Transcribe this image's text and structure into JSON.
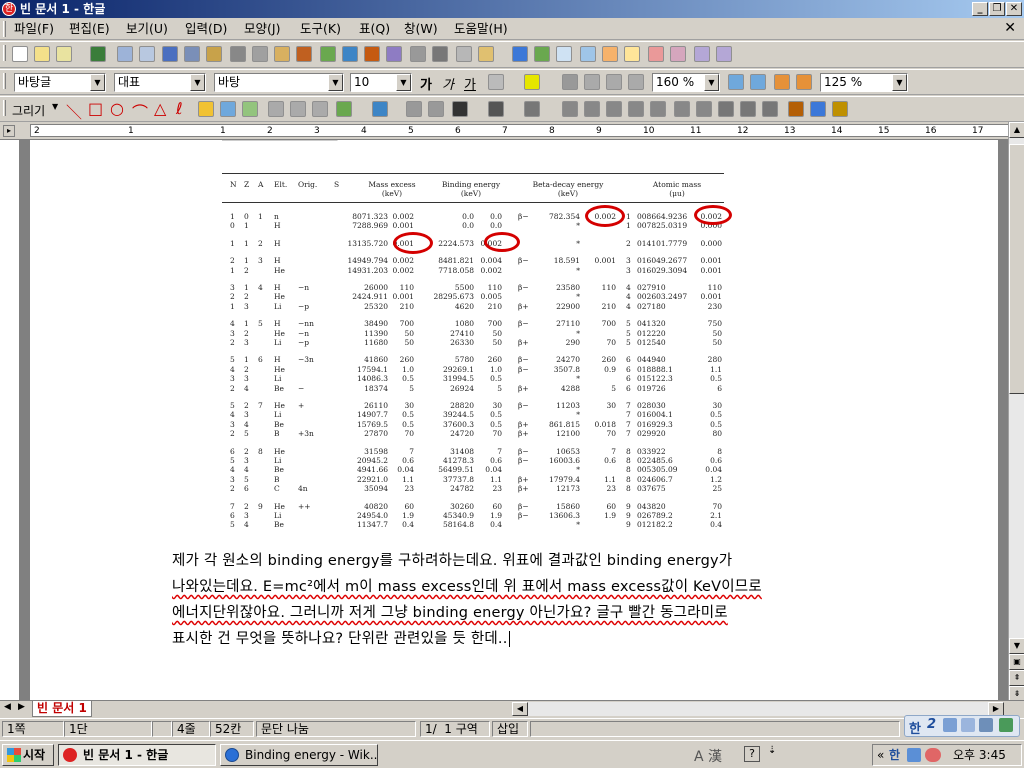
{
  "window": {
    "title": "빈 문서 1 - 한글",
    "app_icon": "hwp-logo-icon",
    "controls": [
      "minimize",
      "restore",
      "close"
    ]
  },
  "menubar": {
    "items": [
      "파일(F)",
      "편집(E)",
      "보기(U)",
      "입력(D)",
      "모양(J)",
      "도구(K)",
      "표(Q)",
      "창(W)",
      "도움말(H)"
    ]
  },
  "format_toolbar": {
    "style": "바탕글",
    "lang": "대표",
    "font": "바탕",
    "size": "10",
    "bold": "가",
    "italic": "가",
    "underline": "가",
    "line_spacing": "160 %",
    "zoom": "125 %"
  },
  "draw_toolbar": {
    "label": "그리기"
  },
  "ruler": {
    "numbers": [
      "2",
      "1",
      "1",
      "2",
      "3",
      "4",
      "5",
      "6",
      "7",
      "8",
      "9",
      "10",
      "11",
      "12",
      "13",
      "14",
      "15",
      "16",
      "17"
    ]
  },
  "table_image": {
    "headers": {
      "n": "N",
      "z": "Z",
      "a": "A",
      "elt": "Elt.",
      "orig": "Orig.",
      "s": "S",
      "mass_excess": "Mass excess\n(keV)",
      "binding": "Binding energy\n(keV)",
      "beta": "Beta-decay energy\n(keV)",
      "atomic": "Atomic mass\n(μu)"
    },
    "rows": [
      [
        "1",
        "0",
        "1",
        "n",
        "",
        "",
        "8071.323",
        "0.002",
        "0.0",
        "0.0",
        "β−",
        "782.354",
        "0.002",
        "1",
        "008664.9236",
        "0.002"
      ],
      [
        "0",
        "1",
        "",
        "H",
        "",
        "",
        "7288.969",
        "0.001",
        "0.0",
        "0.0",
        "",
        "*",
        "",
        "1",
        "007825.0319",
        "0.000"
      ],
      [
        "1",
        "1",
        "2",
        "H",
        "",
        "",
        "13135.720",
        "0.001",
        "2224.573",
        "0.002",
        "",
        "*",
        "",
        "2",
        "014101.7779",
        "0.000"
      ],
      [
        "2",
        "1",
        "3",
        "H",
        "",
        "",
        "14949.794",
        "0.002",
        "8481.821",
        "0.004",
        "β−",
        "18.591",
        "0.001",
        "3",
        "016049.2677",
        "0.001"
      ],
      [
        "1",
        "2",
        "",
        "He",
        "",
        "",
        "14931.203",
        "0.002",
        "7718.058",
        "0.002",
        "",
        "*",
        "",
        "3",
        "016029.3094",
        "0.001"
      ],
      [
        "3",
        "1",
        "4",
        "H",
        "−n",
        "",
        "26000",
        "110",
        "5500",
        "110",
        "β−",
        "23580",
        "110",
        "4",
        "027910",
        "110"
      ],
      [
        "2",
        "2",
        "",
        "He",
        "",
        "",
        "2424.911",
        "0.001",
        "28295.673",
        "0.005",
        "",
        "*",
        "",
        "4",
        "002603.2497",
        "0.001"
      ],
      [
        "1",
        "3",
        "",
        "Li",
        "−p",
        "",
        "25320",
        "210",
        "4620",
        "210",
        "β+",
        "22900",
        "210",
        "4",
        "027180",
        "230"
      ],
      [
        "4",
        "1",
        "5",
        "H",
        "−nn",
        "",
        "38490",
        "700",
        "1080",
        "700",
        "β−",
        "27110",
        "700",
        "5",
        "041320",
        "750"
      ],
      [
        "3",
        "2",
        "",
        "He",
        "−n",
        "",
        "11390",
        "50",
        "27410",
        "50",
        "",
        "*",
        "",
        "5",
        "012220",
        "50"
      ],
      [
        "2",
        "3",
        "",
        "Li",
        "−p",
        "",
        "11680",
        "50",
        "26330",
        "50",
        "β+",
        "290",
        "70",
        "5",
        "012540",
        "50"
      ],
      [
        "5",
        "1",
        "6",
        "H",
        "−3n",
        "",
        "41860",
        "260",
        "5780",
        "260",
        "β−",
        "24270",
        "260",
        "6",
        "044940",
        "280"
      ],
      [
        "4",
        "2",
        "",
        "He",
        "",
        "",
        "17594.1",
        "1.0",
        "29269.1",
        "1.0",
        "β−",
        "3507.8",
        "0.9",
        "6",
        "018888.1",
        "1.1"
      ],
      [
        "3",
        "3",
        "",
        "Li",
        "",
        "",
        "14086.3",
        "0.5",
        "31994.5",
        "0.5",
        "",
        "*",
        "",
        "6",
        "015122.3",
        "0.5"
      ],
      [
        "2",
        "4",
        "",
        "Be",
        "−",
        "",
        "18374",
        "5",
        "26924",
        "5",
        "β+",
        "4288",
        "5",
        "6",
        "019726",
        "6"
      ],
      [
        "5",
        "2",
        "7",
        "He",
        "+",
        "",
        "26110",
        "30",
        "28820",
        "30",
        "β−",
        "11203",
        "30",
        "7",
        "028030",
        "30"
      ],
      [
        "4",
        "3",
        "",
        "Li",
        "",
        "",
        "14907.7",
        "0.5",
        "39244.5",
        "0.5",
        "",
        "*",
        "",
        "7",
        "016004.1",
        "0.5"
      ],
      [
        "3",
        "4",
        "",
        "Be",
        "",
        "",
        "15769.5",
        "0.5",
        "37600.3",
        "0.5",
        "β+",
        "861.815",
        "0.018",
        "7",
        "016929.3",
        "0.5"
      ],
      [
        "2",
        "5",
        "",
        "B",
        "+3n",
        "",
        "27870",
        "70",
        "24720",
        "70",
        "β+",
        "12100",
        "70",
        "7",
        "029920",
        "80"
      ],
      [
        "6",
        "2",
        "8",
        "He",
        "",
        "",
        "31598",
        "7",
        "31408",
        "7",
        "β−",
        "10653",
        "7",
        "8",
        "033922",
        "8"
      ],
      [
        "5",
        "3",
        "",
        "Li",
        "",
        "",
        "20945.2",
        "0.6",
        "41278.3",
        "0.6",
        "β−",
        "16003.6",
        "0.6",
        "8",
        "022485.6",
        "0.6"
      ],
      [
        "4",
        "4",
        "",
        "Be",
        "",
        "",
        "4941.66",
        "0.04",
        "56499.51",
        "0.04",
        "",
        "*",
        "",
        "8",
        "005305.09",
        "0.04"
      ],
      [
        "3",
        "5",
        "",
        "B",
        "",
        "",
        "22921.0",
        "1.1",
        "37737.8",
        "1.1",
        "β+",
        "17979.4",
        "1.1",
        "8",
        "024606.7",
        "1.2"
      ],
      [
        "2",
        "6",
        "",
        "C",
        "4n",
        "",
        "35094",
        "23",
        "24782",
        "23",
        "β+",
        "12173",
        "23",
        "8",
        "037675",
        "25"
      ],
      [
        "7",
        "2",
        "9",
        "He",
        "++",
        "",
        "40820",
        "60",
        "30260",
        "60",
        "β−",
        "15860",
        "60",
        "9",
        "043820",
        "70"
      ],
      [
        "6",
        "3",
        "",
        "Li",
        "",
        "",
        "24954.0",
        "1.9",
        "45340.9",
        "1.9",
        "β−",
        "13606.3",
        "1.9",
        "9",
        "026789.2",
        "2.1"
      ],
      [
        "5",
        "4",
        "",
        "Be",
        "",
        "",
        "11347.7",
        "0.4",
        "58164.8",
        "0.4",
        "",
        "*",
        "",
        "9",
        "012182.2",
        "0.4"
      ]
    ]
  },
  "body_text": {
    "line1": "제가 각 원소의 binding energy를 구하려하는데요. 위표에 결과값인 binding energy가",
    "line2": "나와있는데요. E=mc²에서 m이 mass excess인데 위 표에서 mass excess값이 KeV이므로",
    "line3": "에너지단위잖아요. 그러니까 저게 그냥 binding energy 아닌가요? 글구 빨간 동그라미로",
    "line4": "표시한 건 무엇을 뜻하나요? 단위란 관련있을 듯 한데.."
  },
  "doc_tab": {
    "label": "빈 문서 1"
  },
  "statusbar": {
    "page": "1쪽",
    "section": "1단",
    "line": "4줄",
    "col": "52칸",
    "break": "문단 나눔",
    "count": "1/  1 구역",
    "mode": "삽입"
  },
  "taskbar": {
    "start": "시작",
    "tasks": [
      "빈 문서 1 - 한글",
      "Binding energy - Wik..."
    ],
    "ime": "A 漢",
    "clock": "오후 3:45"
  },
  "colors": {
    "title_grad_start": "#0a246a",
    "title_grad_end": "#a6caf0",
    "circle_red": "#d40000",
    "doc_tab_red": "#c00000"
  }
}
